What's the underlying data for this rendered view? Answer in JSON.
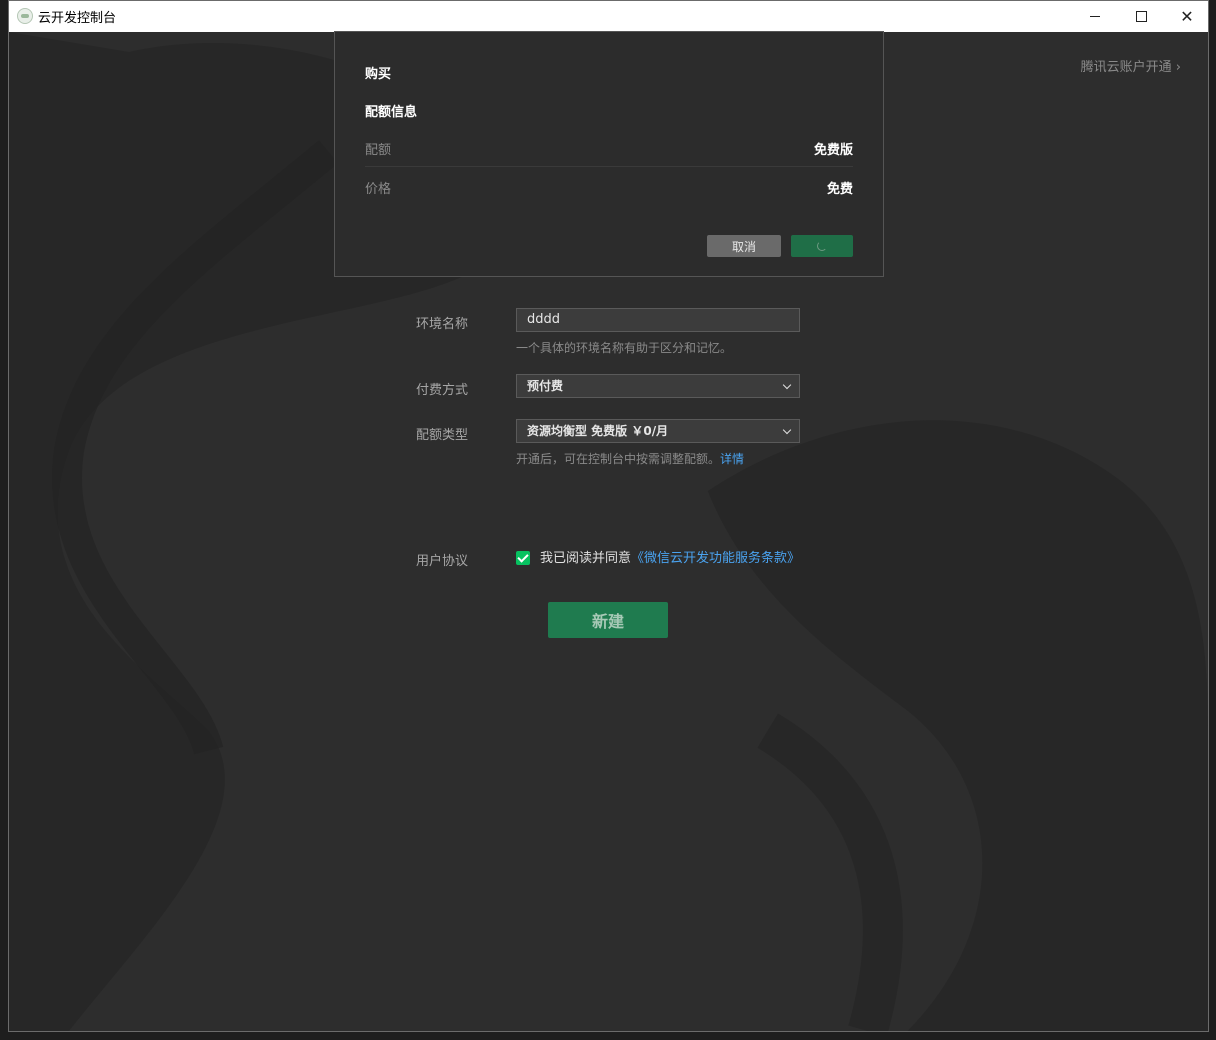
{
  "window": {
    "title": "云开发控制台"
  },
  "header": {
    "account_link": "腾讯云账户开通 ›"
  },
  "dialog": {
    "title": "购买",
    "section": "配额信息",
    "rows": [
      {
        "label": "配额",
        "value": "免费版"
      },
      {
        "label": "价格",
        "value": "免费"
      }
    ],
    "cancel_label": "取消"
  },
  "form": {
    "env_name": {
      "label": "环境名称",
      "value": "dddd",
      "hint": "一个具体的环境名称有助于区分和记忆。"
    },
    "payment": {
      "label": "付费方式",
      "selected": "预付费"
    },
    "quota": {
      "label": "配额类型",
      "selected": "资源均衡型 免费版 ￥0/月",
      "hint": "开通后，可在控制台中按需调整配额。",
      "hint_link": "详情"
    },
    "agreement": {
      "label": "用户协议",
      "text": "我已阅读并同意",
      "link": "《微信云开发功能服务条款》",
      "checked": true
    },
    "create_label": "新建"
  },
  "colors": {
    "accent_green": "#07c160",
    "button_green": "#1f7b4f",
    "link_blue": "#4aa3f0"
  }
}
